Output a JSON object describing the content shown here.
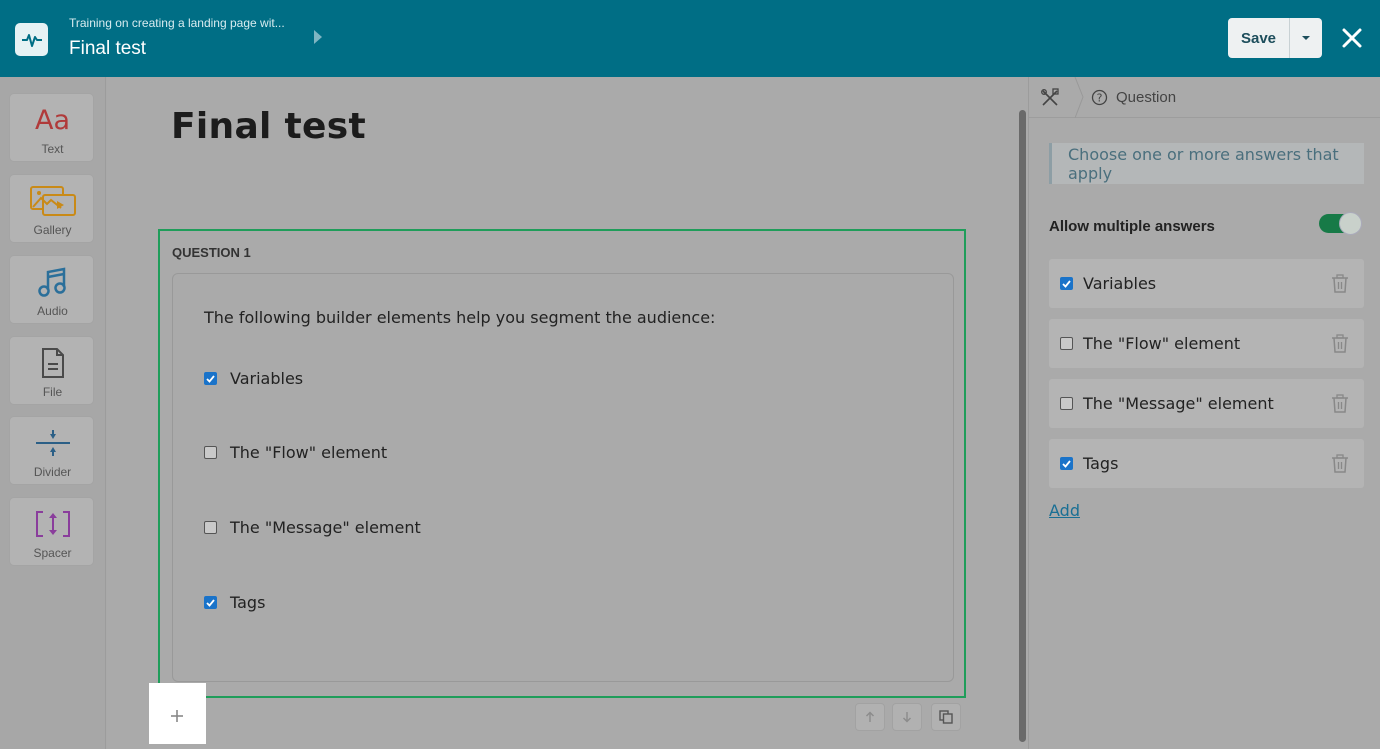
{
  "header": {
    "breadcrumb": "Training on creating a landing page wit...",
    "title": "Final test",
    "save_label": "Save",
    "logo_icon": "pulse-icon",
    "close_icon": "close-icon"
  },
  "sidebar": {
    "items": [
      {
        "label": "Text",
        "icon": "text-aa-icon",
        "glyph": "Aa"
      },
      {
        "label": "Gallery",
        "icon": "gallery-icon"
      },
      {
        "label": "Audio",
        "icon": "music-note-icon"
      },
      {
        "label": "File",
        "icon": "file-icon"
      },
      {
        "label": "Divider",
        "icon": "divider-icon"
      },
      {
        "label": "Spacer",
        "icon": "spacer-icon"
      }
    ]
  },
  "page": {
    "title": "Final test"
  },
  "question": {
    "label": "QUESTION 1",
    "text": "The following builder elements help you segment the audience:",
    "options": [
      {
        "label": "Variables",
        "checked": true
      },
      {
        "label": "The \"Flow\" element",
        "checked": false
      },
      {
        "label": "The \"Message\" element",
        "checked": false
      },
      {
        "label": "Tags",
        "checked": true
      }
    ]
  },
  "panel": {
    "breadcrumb": "Question",
    "hint": "Choose one or more answers that apply",
    "allow_multiple_label": "Allow multiple answers",
    "allow_multiple": true,
    "answers": [
      {
        "label": "Variables",
        "checked": true
      },
      {
        "label": "The \"Flow\" element",
        "checked": false
      },
      {
        "label": "The \"Message\" element",
        "checked": false
      },
      {
        "label": "Tags",
        "checked": true
      }
    ],
    "add_label": "Add"
  },
  "colors": {
    "header_bg": "#006e85",
    "selection_border": "#1f9d5a",
    "checkbox_on": "#1a73c9",
    "toggle_on": "#177a47"
  }
}
